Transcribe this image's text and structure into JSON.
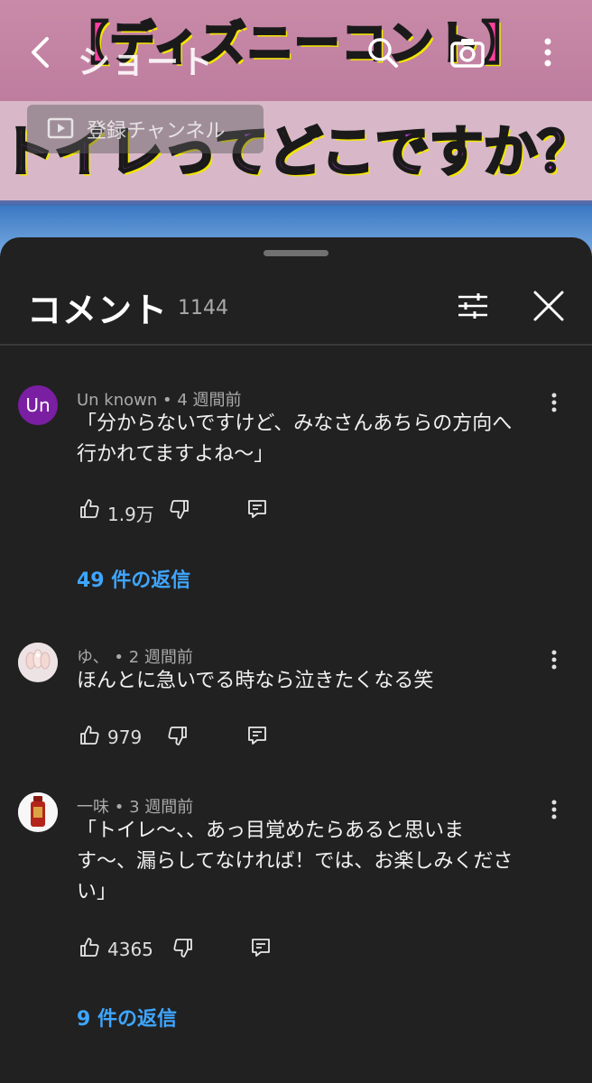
{
  "video": {
    "thumb_title_1": "【ディズニーコント】",
    "thumb_title_2": "トイレってどこですか？",
    "subscribe_label": "登録チャンネル"
  },
  "topbar": {
    "title": "ショート",
    "icons": [
      "back-icon",
      "search-icon",
      "camera-icon",
      "more-vertical-icon"
    ]
  },
  "sheet": {
    "title": "コメント",
    "count": "1144",
    "icons": [
      "filter-icon",
      "close-icon"
    ]
  },
  "comments": [
    {
      "author": "Un known",
      "time": "4 週間前",
      "avatar_text": "Un",
      "avatar_color": "#7b1fa2",
      "text_lines": [
        "「分からないですけど、みなさんあちらの方向へ",
        "行かれてますよね〜」"
      ],
      "likes": "1.9万",
      "replies": "49 件の返信"
    },
    {
      "author": "ゆ、",
      "time": "2 週間前",
      "text_lines": [
        "ほんとに急いでる時なら泣きたくなる笑"
      ],
      "likes": "979"
    },
    {
      "author": "一味",
      "time": "3 週間前",
      "text_lines": [
        "「トイレ〜、、あっ目覚めたらあると思いま",
        "す〜、漏らしてなければ！では、お楽しみくださ",
        "い」"
      ],
      "likes": "4365",
      "replies": "9 件の返信"
    }
  ],
  "separator": " • ",
  "colors": {
    "accent_link": "#3ea6ff",
    "sheet_bg": "#212121",
    "secondary_text": "#aaaaaa"
  }
}
